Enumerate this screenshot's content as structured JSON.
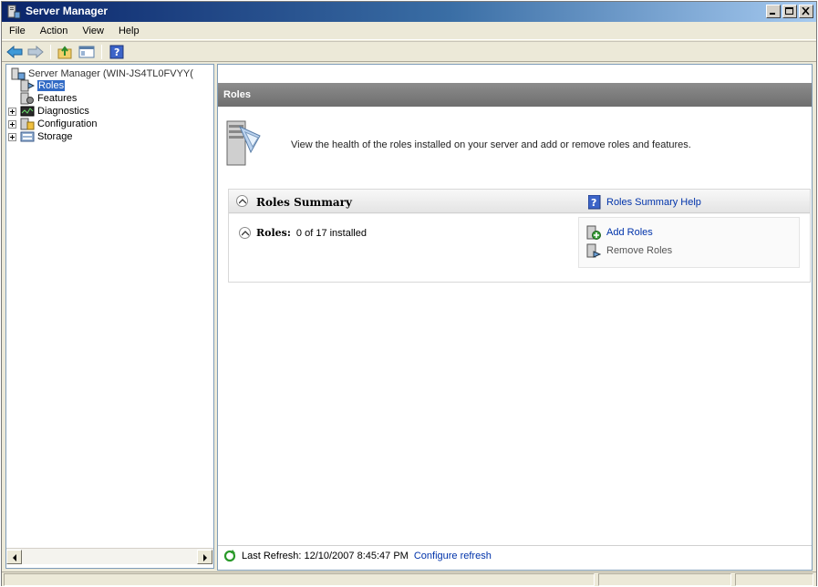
{
  "window": {
    "title": "Server Manager"
  },
  "menu": [
    "File",
    "Action",
    "View",
    "Help"
  ],
  "toolbar": {
    "buttons": [
      "back-icon",
      "forward-icon",
      "up-folder-icon",
      "show-hide-console-tree-icon",
      "help-icon"
    ]
  },
  "tree": {
    "root": "Server Manager (WIN-JS4TL0FVYY(",
    "items": [
      {
        "label": "Roles",
        "selected": true,
        "expandable": false
      },
      {
        "label": "Features",
        "selected": false,
        "expandable": false
      },
      {
        "label": "Diagnostics",
        "selected": false,
        "expandable": true
      },
      {
        "label": "Configuration",
        "selected": false,
        "expandable": true
      },
      {
        "label": "Storage",
        "selected": false,
        "expandable": true
      }
    ]
  },
  "main": {
    "header": "Roles",
    "intro": "View the health of the roles installed on your server and add or remove roles and features.",
    "summary": {
      "title": "Roles Summary",
      "help_link": "Roles Summary Help",
      "roles_label": "Roles:",
      "roles_value": "0 of 17 installed",
      "add_roles": "Add Roles",
      "remove_roles": "Remove Roles"
    },
    "footer": {
      "last_refresh": "Last Refresh: 12/10/2007 8:45:47 PM",
      "configure_refresh": "Configure refresh"
    }
  }
}
